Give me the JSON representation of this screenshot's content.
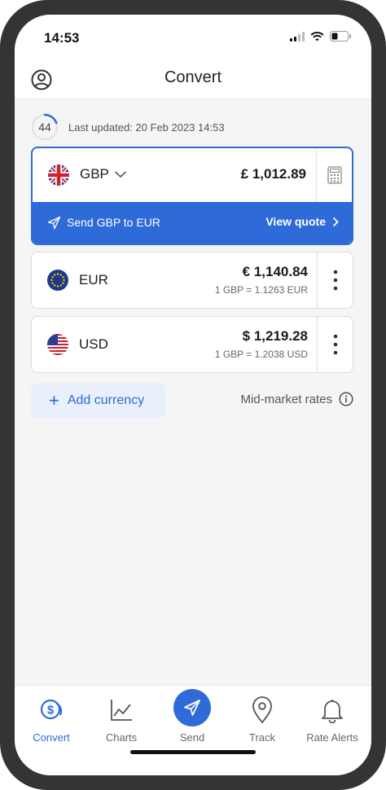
{
  "status_bar": {
    "time": "14:53"
  },
  "header": {
    "title": "Convert"
  },
  "updated": {
    "countdown": "44",
    "text": "Last updated: 20 Feb 2023 14:53"
  },
  "base_currency": {
    "code": "GBP",
    "amount": "£ 1,012.89",
    "send_label": "Send GBP to EUR",
    "view_quote_label": "View quote"
  },
  "currencies": [
    {
      "code": "EUR",
      "amount": "€ 1,140.84",
      "rate": "1 GBP = 1.1263 EUR"
    },
    {
      "code": "USD",
      "amount": "$ 1,219.28",
      "rate": "1 GBP = 1.2038 USD"
    }
  ],
  "actions": {
    "add_currency_label": "Add currency",
    "midmarket_label": "Mid-market rates"
  },
  "tabs": [
    {
      "label": "Convert",
      "icon": "convert-icon",
      "active": true
    },
    {
      "label": "Charts",
      "icon": "chart-icon"
    },
    {
      "label": "Send",
      "icon": "send-icon"
    },
    {
      "label": "Track",
      "icon": "location-pin-icon"
    },
    {
      "label": "Rate Alerts",
      "icon": "bell-icon"
    }
  ],
  "colors": {
    "accent": "#2f6bd8",
    "background": "#f5f5f5",
    "text": "#1b1b1b"
  }
}
